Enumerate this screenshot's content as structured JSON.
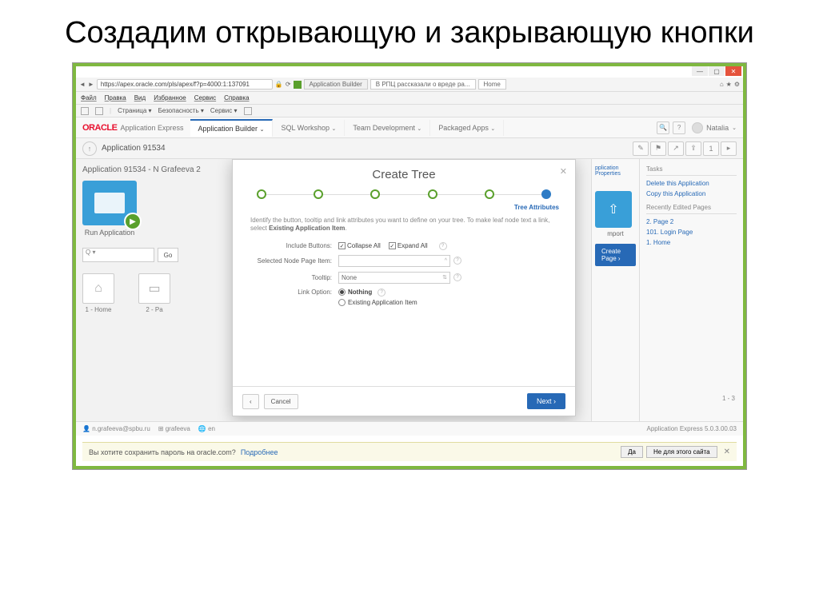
{
  "slide": {
    "title": "Создадим открывающую и закрывающую кнопки"
  },
  "window_buttons": {
    "min": "—",
    "max": "▢",
    "close": "✕"
  },
  "browser": {
    "url": "https://apex.oracle.com/pls/apex/f?p=4000:1:137091",
    "tabs": [
      "Application Builder",
      "В РПЦ рассказали о вреде ра...",
      "Home"
    ]
  },
  "menu": [
    "Файл",
    "Правка",
    "Вид",
    "Избранное",
    "Сервис",
    "Справка"
  ],
  "toolbar2": [
    "Страница ▾",
    "Безопасность ▾",
    "Сервис ▾"
  ],
  "apex": {
    "logo": "ORACLE",
    "product": "Application Express",
    "tabs": [
      "Application Builder",
      "SQL Workshop",
      "Team Development",
      "Packaged Apps"
    ],
    "user": "Natalia"
  },
  "breadcrumb": {
    "text": "Application 91534"
  },
  "page_header": "Application 91534 - N Grafeeva 2",
  "tile_run": "Run Application",
  "search": {
    "placeholder": "Q",
    "go": "Go"
  },
  "small_tiles": [
    "1 - Home",
    "2 - Pa"
  ],
  "sidebar": {
    "props_label": "pplication Properties",
    "tasks_label": "Tasks",
    "delete": "Delete this Application",
    "copy": "Copy this Application",
    "recent_label": "Recently Edited Pages",
    "recent": [
      "2. Page 2",
      "101. Login Page",
      "1. Home"
    ],
    "create_page": "Create Page"
  },
  "pager": "1 - 3",
  "footer": {
    "user_email": "n.grafeeva@spbu.ru",
    "workspace": "grafeeva",
    "lang": "en",
    "version": "Application Express 5.0.3.00.03"
  },
  "save_pwd": {
    "question": "Вы хотите сохранить пароль на oracle.com?",
    "more": "Подробнее",
    "yes": "Да",
    "no": "Не для этого сайта"
  },
  "modal": {
    "title": "Create Tree",
    "step_label": "Tree Attributes",
    "close": "✕",
    "instruction_1": "Identify the button, tooltip and link attributes you want to define on your tree. To make leaf node text a link, select ",
    "instruction_2": "Existing Application Item",
    "include_buttons_label": "Include Buttons:",
    "collapse": "Collapse All",
    "expand": "Expand All",
    "selected_node_label": "Selected Node Page Item:",
    "tooltip_label": "Tooltip:",
    "tooltip_value": "None",
    "link_option_label": "Link Option:",
    "link_nothing": "Nothing",
    "link_existing": "Existing Application Item",
    "back": "‹",
    "cancel": "Cancel",
    "next": "Next ›"
  }
}
